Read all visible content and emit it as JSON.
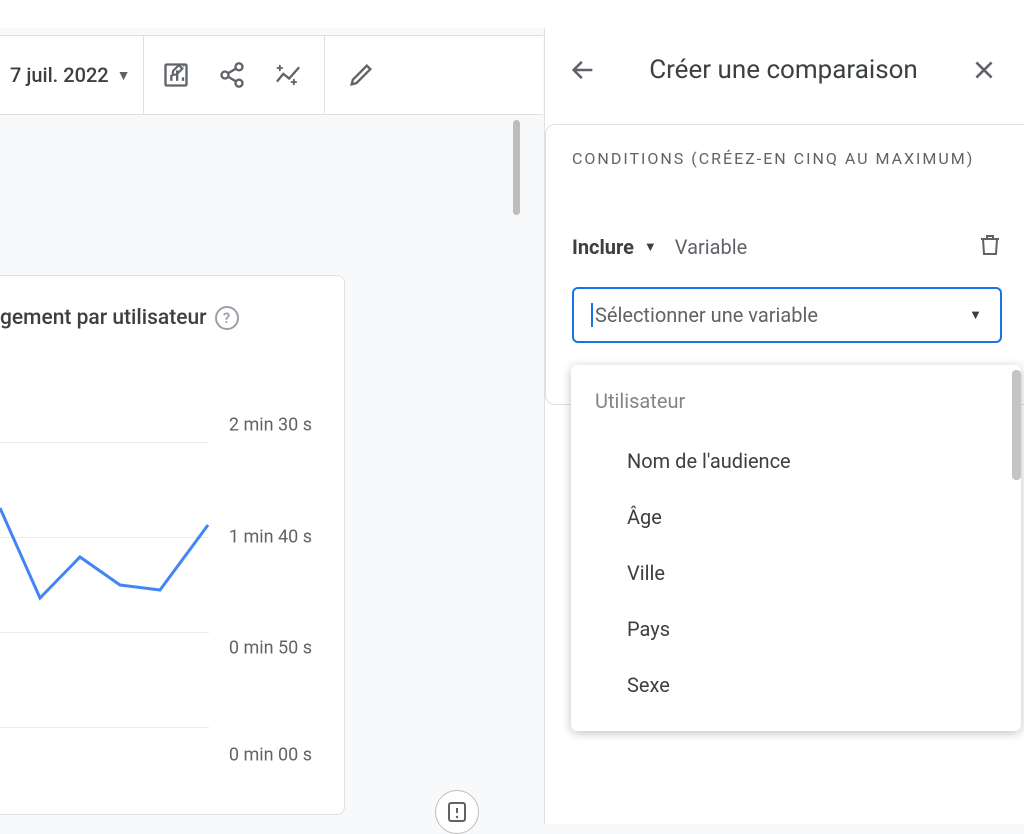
{
  "toolbar": {
    "date_range": "7 juil. 2022"
  },
  "card": {
    "title": "gement par utilisateur"
  },
  "chart_data": {
    "type": "line",
    "title": "gement par utilisateur",
    "ylabel": "",
    "y_ticks": [
      "2 min 30 s",
      "1 min 40 s",
      "0 min 50 s",
      "0 min 00 s"
    ],
    "ylim": [
      0,
      150
    ],
    "x": [
      0,
      1,
      2,
      3,
      4,
      5
    ],
    "values": [
      115,
      68,
      90,
      75,
      72,
      106
    ],
    "series_color": "#4285f4"
  },
  "panel": {
    "title": "Créer une comparaison",
    "conditions_label": "Conditions (créez-en cinq au maximum)",
    "include_label": "Inclure",
    "variable_label": "Variable",
    "select_placeholder": "Sélectionner une variable"
  },
  "dropdown": {
    "group_label": "Utilisateur",
    "items": [
      "Nom de l'audience",
      "Âge",
      "Ville",
      "Pays",
      "Sexe"
    ]
  }
}
